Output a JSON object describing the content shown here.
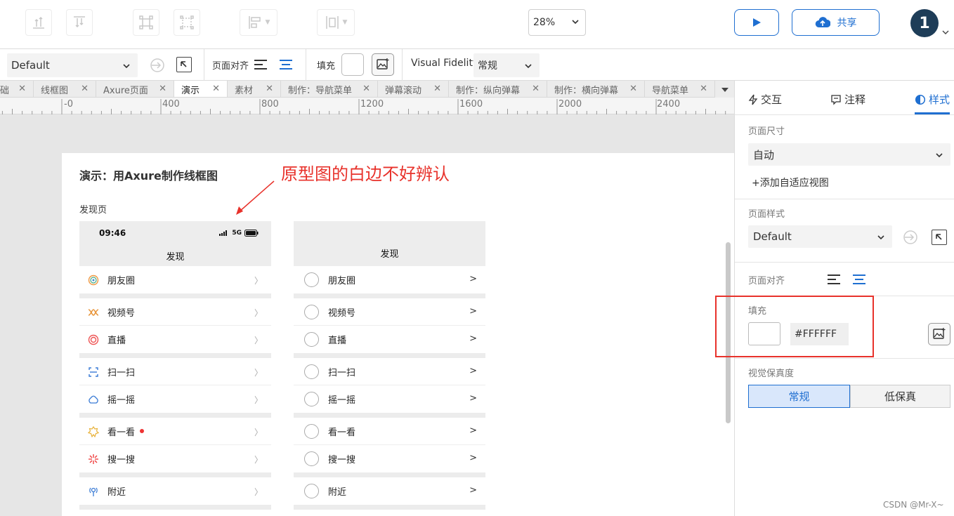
{
  "toolbar": {
    "zoom": "28%",
    "share_label": "共享",
    "avatar_initial": "1"
  },
  "stylebar": {
    "page_style": "Default",
    "align_label": "页面对齐",
    "fill_label": "填充",
    "fidelity_label": "Visual Fidelity",
    "fidelity_value": "常规"
  },
  "tabs": [
    {
      "label": "础",
      "active": false
    },
    {
      "label": "线框图",
      "active": false
    },
    {
      "label": "Axure页面",
      "active": false
    },
    {
      "label": "演示",
      "active": true
    },
    {
      "label": "素材",
      "active": false
    },
    {
      "label": "制作：导航菜单",
      "active": false
    },
    {
      "label": "弹幕滚动",
      "active": false
    },
    {
      "label": "制作：纵向弹幕",
      "active": false
    },
    {
      "label": "制作：横向弹幕",
      "active": false
    },
    {
      "label": "导航菜单",
      "active": false
    }
  ],
  "ruler": [
    "-0",
    "400",
    "800",
    "1200",
    "1600",
    "2000",
    "2400"
  ],
  "canvas": {
    "page_title": "演示：用Axure制作线框图",
    "annotation": "原型图的白边不好辨认",
    "page_label": "发现页",
    "phone_time": "09:46",
    "phone_network": "5G",
    "phone_title": "发现",
    "wireframe_title": "发现",
    "chevron": ">",
    "items": [
      {
        "label": "朋友圈",
        "icon": "moments-icon"
      },
      {
        "label": "视频号",
        "icon": "channels-icon"
      },
      {
        "label": "直播",
        "icon": "live-icon"
      },
      {
        "label": "扫一扫",
        "icon": "scan-icon"
      },
      {
        "label": "摇一摇",
        "icon": "shake-icon"
      },
      {
        "label": "看一看",
        "icon": "top-stories-icon"
      },
      {
        "label": "搜一搜",
        "icon": "search-icon"
      },
      {
        "label": "附近",
        "icon": "nearby-icon"
      }
    ]
  },
  "panel": {
    "tab_interaction": "交互",
    "tab_notes": "注释",
    "tab_style": "样式",
    "page_size_label": "页面尺寸",
    "page_size_value": "自动",
    "add_adaptive": "+添加自适应视图",
    "page_style_label": "页面样式",
    "page_style_value": "Default",
    "page_align_label": "页面对齐",
    "fill_label": "填充",
    "fill_hex": "#FFFFFF",
    "fidelity_label": "视觉保真度",
    "fidelity_normal": "常规",
    "fidelity_low": "低保真"
  },
  "watermark": "CSDN @Mr-X~",
  "colors": {
    "accent": "#1f6fd1",
    "annotation_red": "#e8322b",
    "avatar_bg": "#1e3d58"
  }
}
